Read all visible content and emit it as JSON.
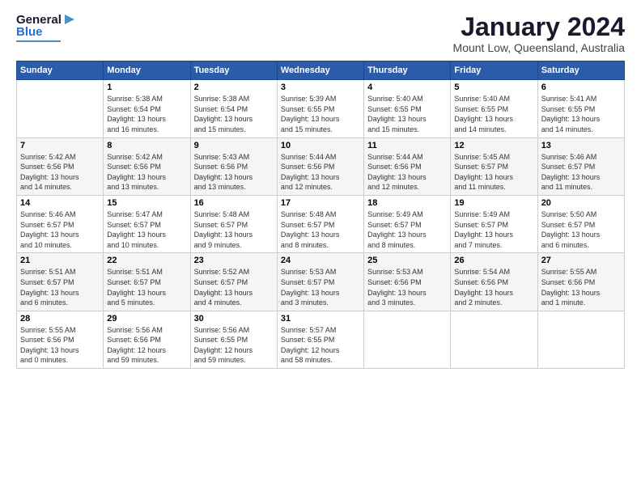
{
  "header": {
    "logo_general": "General",
    "logo_blue": "Blue",
    "title": "January 2024",
    "subtitle": "Mount Low, Queensland, Australia"
  },
  "days_of_week": [
    "Sunday",
    "Monday",
    "Tuesday",
    "Wednesday",
    "Thursday",
    "Friday",
    "Saturday"
  ],
  "weeks": [
    {
      "days": [
        {
          "num": "",
          "info": ""
        },
        {
          "num": "1",
          "info": "Sunrise: 5:38 AM\nSunset: 6:54 PM\nDaylight: 13 hours\nand 16 minutes."
        },
        {
          "num": "2",
          "info": "Sunrise: 5:38 AM\nSunset: 6:54 PM\nDaylight: 13 hours\nand 15 minutes."
        },
        {
          "num": "3",
          "info": "Sunrise: 5:39 AM\nSunset: 6:55 PM\nDaylight: 13 hours\nand 15 minutes."
        },
        {
          "num": "4",
          "info": "Sunrise: 5:40 AM\nSunset: 6:55 PM\nDaylight: 13 hours\nand 15 minutes."
        },
        {
          "num": "5",
          "info": "Sunrise: 5:40 AM\nSunset: 6:55 PM\nDaylight: 13 hours\nand 14 minutes."
        },
        {
          "num": "6",
          "info": "Sunrise: 5:41 AM\nSunset: 6:55 PM\nDaylight: 13 hours\nand 14 minutes."
        }
      ]
    },
    {
      "days": [
        {
          "num": "7",
          "info": "Sunrise: 5:42 AM\nSunset: 6:56 PM\nDaylight: 13 hours\nand 14 minutes."
        },
        {
          "num": "8",
          "info": "Sunrise: 5:42 AM\nSunset: 6:56 PM\nDaylight: 13 hours\nand 13 minutes."
        },
        {
          "num": "9",
          "info": "Sunrise: 5:43 AM\nSunset: 6:56 PM\nDaylight: 13 hours\nand 13 minutes."
        },
        {
          "num": "10",
          "info": "Sunrise: 5:44 AM\nSunset: 6:56 PM\nDaylight: 13 hours\nand 12 minutes."
        },
        {
          "num": "11",
          "info": "Sunrise: 5:44 AM\nSunset: 6:56 PM\nDaylight: 13 hours\nand 12 minutes."
        },
        {
          "num": "12",
          "info": "Sunrise: 5:45 AM\nSunset: 6:57 PM\nDaylight: 13 hours\nand 11 minutes."
        },
        {
          "num": "13",
          "info": "Sunrise: 5:46 AM\nSunset: 6:57 PM\nDaylight: 13 hours\nand 11 minutes."
        }
      ]
    },
    {
      "days": [
        {
          "num": "14",
          "info": "Sunrise: 5:46 AM\nSunset: 6:57 PM\nDaylight: 13 hours\nand 10 minutes."
        },
        {
          "num": "15",
          "info": "Sunrise: 5:47 AM\nSunset: 6:57 PM\nDaylight: 13 hours\nand 10 minutes."
        },
        {
          "num": "16",
          "info": "Sunrise: 5:48 AM\nSunset: 6:57 PM\nDaylight: 13 hours\nand 9 minutes."
        },
        {
          "num": "17",
          "info": "Sunrise: 5:48 AM\nSunset: 6:57 PM\nDaylight: 13 hours\nand 8 minutes."
        },
        {
          "num": "18",
          "info": "Sunrise: 5:49 AM\nSunset: 6:57 PM\nDaylight: 13 hours\nand 8 minutes."
        },
        {
          "num": "19",
          "info": "Sunrise: 5:49 AM\nSunset: 6:57 PM\nDaylight: 13 hours\nand 7 minutes."
        },
        {
          "num": "20",
          "info": "Sunrise: 5:50 AM\nSunset: 6:57 PM\nDaylight: 13 hours\nand 6 minutes."
        }
      ]
    },
    {
      "days": [
        {
          "num": "21",
          "info": "Sunrise: 5:51 AM\nSunset: 6:57 PM\nDaylight: 13 hours\nand 6 minutes."
        },
        {
          "num": "22",
          "info": "Sunrise: 5:51 AM\nSunset: 6:57 PM\nDaylight: 13 hours\nand 5 minutes."
        },
        {
          "num": "23",
          "info": "Sunrise: 5:52 AM\nSunset: 6:57 PM\nDaylight: 13 hours\nand 4 minutes."
        },
        {
          "num": "24",
          "info": "Sunrise: 5:53 AM\nSunset: 6:57 PM\nDaylight: 13 hours\nand 3 minutes."
        },
        {
          "num": "25",
          "info": "Sunrise: 5:53 AM\nSunset: 6:56 PM\nDaylight: 13 hours\nand 3 minutes."
        },
        {
          "num": "26",
          "info": "Sunrise: 5:54 AM\nSunset: 6:56 PM\nDaylight: 13 hours\nand 2 minutes."
        },
        {
          "num": "27",
          "info": "Sunrise: 5:55 AM\nSunset: 6:56 PM\nDaylight: 13 hours\nand 1 minute."
        }
      ]
    },
    {
      "days": [
        {
          "num": "28",
          "info": "Sunrise: 5:55 AM\nSunset: 6:56 PM\nDaylight: 13 hours\nand 0 minutes."
        },
        {
          "num": "29",
          "info": "Sunrise: 5:56 AM\nSunset: 6:56 PM\nDaylight: 12 hours\nand 59 minutes."
        },
        {
          "num": "30",
          "info": "Sunrise: 5:56 AM\nSunset: 6:55 PM\nDaylight: 12 hours\nand 59 minutes."
        },
        {
          "num": "31",
          "info": "Sunrise: 5:57 AM\nSunset: 6:55 PM\nDaylight: 12 hours\nand 58 minutes."
        },
        {
          "num": "",
          "info": ""
        },
        {
          "num": "",
          "info": ""
        },
        {
          "num": "",
          "info": ""
        }
      ]
    }
  ]
}
